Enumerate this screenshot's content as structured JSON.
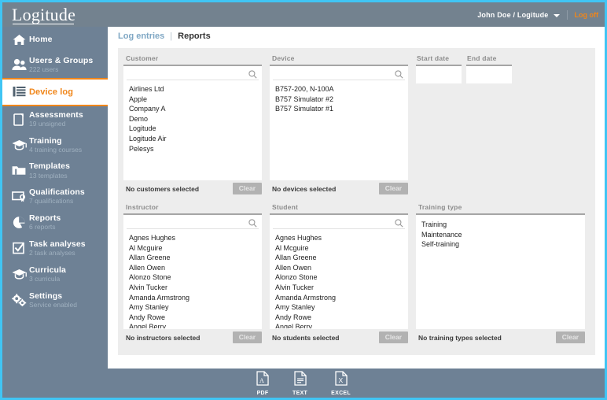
{
  "app": {
    "logo": "Logitude",
    "accent_orange": "#f0861a",
    "sidebar_bg": "#6e8195",
    "window_border": "#40c5f4"
  },
  "header": {
    "user": "John Doe / Logitude",
    "dropdown_icon": "chevron-down-icon",
    "logoff": "Log off"
  },
  "sidebar": {
    "items": [
      {
        "icon": "home-icon",
        "label": "Home",
        "sub": ""
      },
      {
        "icon": "users-icon",
        "label": "Users & Groups",
        "sub": "222 users"
      },
      {
        "icon": "list-icon",
        "label": "Device log",
        "sub": "",
        "active": true
      },
      {
        "icon": "clipboard-icon",
        "label": "Assessments",
        "sub": "19 unsigned"
      },
      {
        "icon": "graduation-cap-icon",
        "label": "Training",
        "sub": "4 training courses"
      },
      {
        "icon": "folder-icon",
        "label": "Templates",
        "sub": "13 templates"
      },
      {
        "icon": "certificate-icon",
        "label": "Qualifications",
        "sub": "7 qualifications"
      },
      {
        "icon": "pie-chart-icon",
        "label": "Reports",
        "sub": "6 reports"
      },
      {
        "icon": "checkbox-icon",
        "label": "Task analyses",
        "sub": "2 task analyses"
      },
      {
        "icon": "graduation-cap-icon",
        "label": "Curricula",
        "sub": "3 curricula"
      },
      {
        "icon": "gears-icon",
        "label": "Settings",
        "sub": "Service enabled"
      }
    ]
  },
  "tabs": {
    "log_entries": "Log entries",
    "separator": "|",
    "reports": "Reports"
  },
  "panels": {
    "customer": {
      "title": "Customer",
      "search_value": "",
      "search_placeholder": "",
      "items": [
        "Airlines Ltd",
        "Apple",
        "Company A",
        "Demo",
        "Logitude",
        "Logitude Air",
        "Pelesys"
      ],
      "status": "No customers selected",
      "clear": "Clear"
    },
    "device": {
      "title": "Device",
      "search_value": "",
      "search_placeholder": "",
      "items": [
        "B757-200, N-100A",
        "B757 Simulator #2",
        "B757 Simulator #1"
      ],
      "status": "No devices selected",
      "clear": "Clear"
    },
    "dates": {
      "start_label": "Start date",
      "start_value": "",
      "end_label": "End date",
      "end_value": ""
    },
    "instructor": {
      "title": "Instructor",
      "search_value": "",
      "search_placeholder": "",
      "items": [
        "Agnes Hughes",
        "Al Mcguire",
        "Allan Greene",
        "Allen Owen",
        "Alonzo Stone",
        "Alvin Tucker",
        "Amanda Armstrong",
        "Amy Stanley",
        "Andy Rowe",
        "Angel Berry"
      ],
      "status": "No instructors selected",
      "clear": "Clear"
    },
    "student": {
      "title": "Student",
      "search_value": "",
      "search_placeholder": "",
      "items": [
        "Agnes Hughes",
        "Al Mcguire",
        "Allan Greene",
        "Allen Owen",
        "Alonzo Stone",
        "Alvin Tucker",
        "Amanda Armstrong",
        "Amy Stanley",
        "Andy Rowe",
        "Angel Berry"
      ],
      "status": "No students selected",
      "clear": "Clear"
    },
    "training_type": {
      "title": "Training type",
      "items": [
        "Training",
        "Maintenance",
        "Self-training"
      ],
      "status": "No training types selected",
      "clear": "Clear"
    }
  },
  "footer": {
    "exports": [
      {
        "icon": "pdf-file-icon",
        "label": "PDF"
      },
      {
        "icon": "text-file-icon",
        "label": "TEXT"
      },
      {
        "icon": "excel-file-icon",
        "label": "EXCEL"
      }
    ]
  }
}
